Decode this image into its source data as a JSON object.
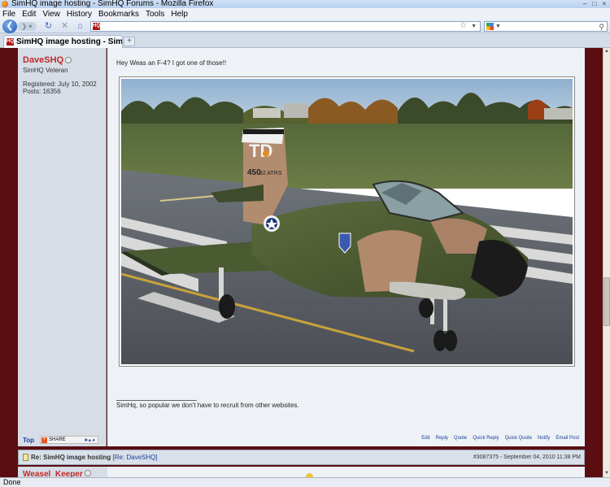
{
  "window": {
    "title": "SimHQ image hosting - SimHQ Forums - Mozilla Firefox"
  },
  "menu": [
    "File",
    "Edit",
    "View",
    "History",
    "Bookmarks",
    "Tools",
    "Help"
  ],
  "tab": {
    "title": "SimHQ image hosting - SimHQ ..."
  },
  "post": {
    "username": "DaveSHQ",
    "rank": "SimHQ Veteran",
    "registered": "Registered: July 10, 2002",
    "posts": "Posts: 16356",
    "message": "Hey Weas an F-4? I got one of those!!",
    "signature": "SimHq, so popular we don't have to recruit from other websites.",
    "top_link": "Top",
    "share_label": "SHARE",
    "actions": [
      "Edit",
      "Reply",
      "Quote",
      "Quick Reply",
      "Quick Quote",
      "Notify",
      "Email Post"
    ]
  },
  "next_post": {
    "title": "Re: SimHQ image hosting",
    "re_link": "[Re: DaveSHQ]",
    "meta": "#3087375 - September 04, 2010 11:38 PM",
    "username": "Weasel_Keeper"
  },
  "aircraft_markings": {
    "tail_code": "TD",
    "serial": "450",
    "unit": "82 ATRS"
  },
  "statusbar": {
    "text": "Done"
  }
}
